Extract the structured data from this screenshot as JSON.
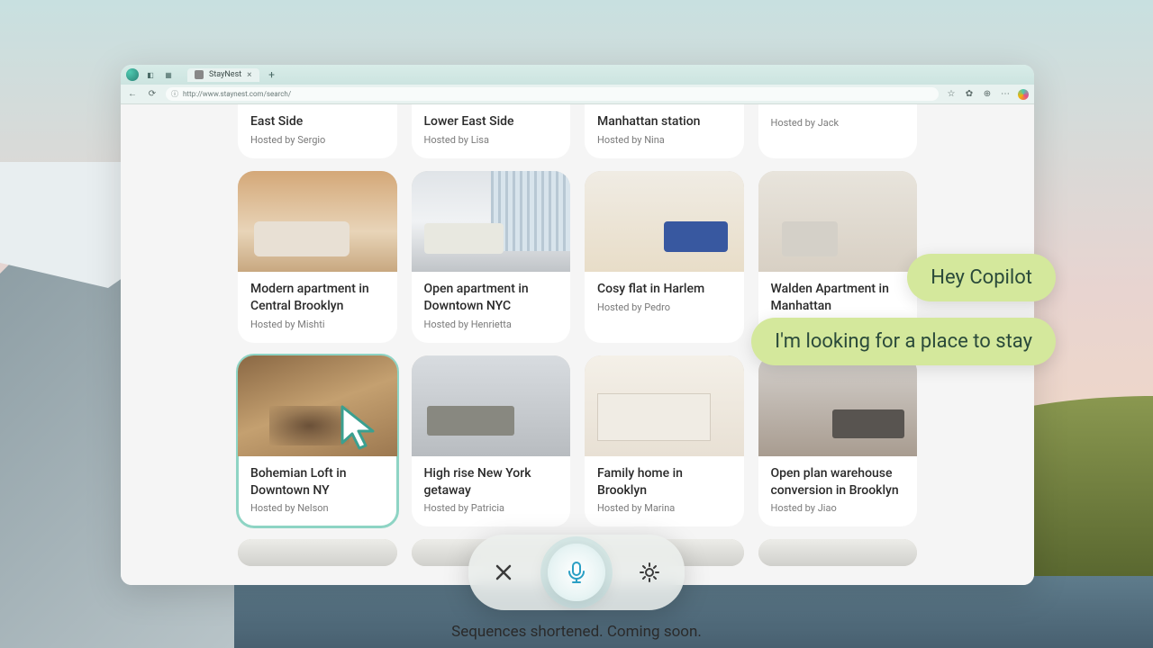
{
  "browser": {
    "tab_title": "StayNest",
    "url": "http://www.staynest.com/search/"
  },
  "listings": {
    "row0": [
      {
        "title_line2": "East Side",
        "host": "Hosted by Sergio"
      },
      {
        "title_line2": "Lower East Side",
        "host": "Hosted by Lisa"
      },
      {
        "title_line2": "Manhattan station",
        "host": "Hosted by Nina"
      },
      {
        "title_line2": "",
        "host": "Hosted by Jack"
      }
    ],
    "row1": [
      {
        "title": "Modern apartment in Central Brooklyn",
        "host": "Hosted by Mishti"
      },
      {
        "title": "Open apartment in Downtown NYC",
        "host": "Hosted by Henrietta"
      },
      {
        "title": "Cosy flat in Harlem",
        "host": "Hosted by Pedro"
      },
      {
        "title": "Walden Apartment in Manhattan",
        "host": ""
      }
    ],
    "row2": [
      {
        "title": "Bohemian Loft in Downtown NY",
        "host": "Hosted by Nelson"
      },
      {
        "title": "High rise New York getaway",
        "host": "Hosted by Patricia"
      },
      {
        "title": "Family home in Brooklyn",
        "host": "Hosted by Marina"
      },
      {
        "title": "Open plan warehouse conversion in Brooklyn",
        "host": "Hosted by Jiao"
      }
    ]
  },
  "copilot": {
    "bubble1": "Hey Copilot",
    "bubble2": "I'm looking for a place to stay"
  },
  "disclaimer": "Sequences shortened. Coming soon."
}
